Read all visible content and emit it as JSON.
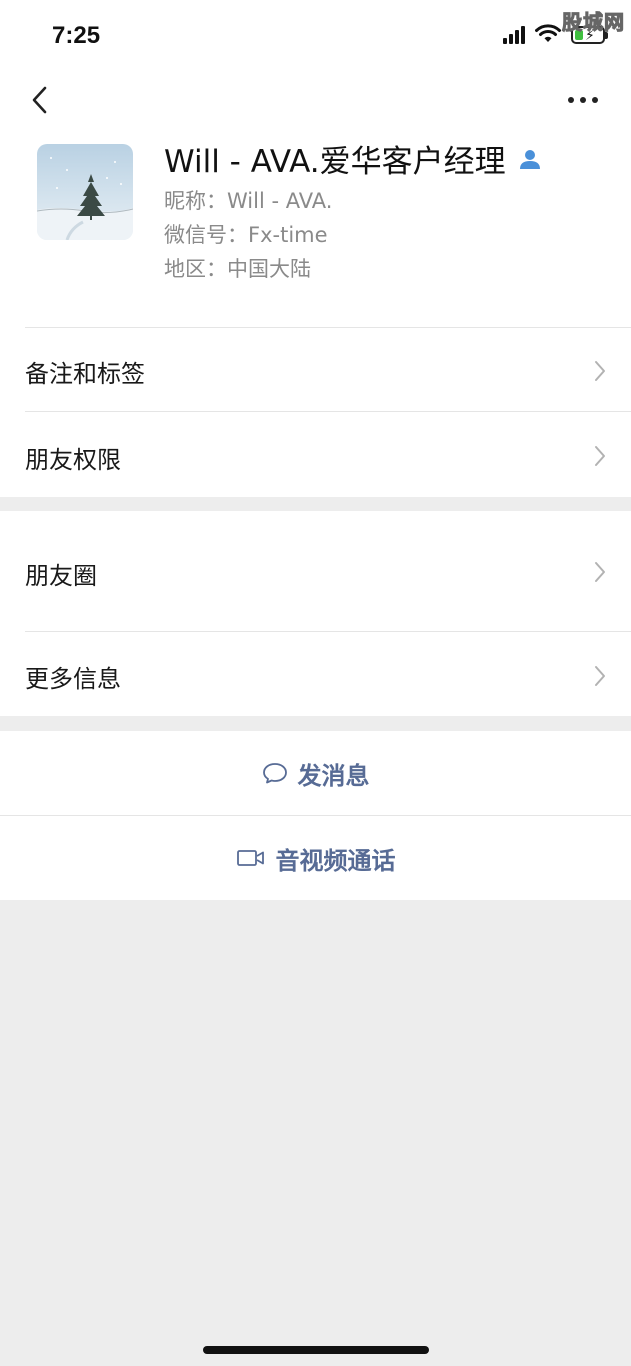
{
  "status_bar": {
    "time": "7:25",
    "watermark": "股城网",
    "icons": [
      "signal-icon",
      "wifi-icon",
      "battery-charging-icon"
    ]
  },
  "nav": {
    "back_icon": "chevron-left-icon",
    "more_icon": "more-dots-icon"
  },
  "profile": {
    "name": "Will - AVA.爱华客户经理",
    "nickname": "昵称：Will - AVA.",
    "wechat_id": "微信号：Fx-time",
    "region": "地区：中国大陆",
    "contact_icon": "contact-person-icon"
  },
  "menu": {
    "remarks_tags": "备注和标签",
    "friend_permissions": "朋友权限",
    "moments": "朋友圈",
    "more_info": "更多信息"
  },
  "actions": {
    "send_message": "发消息",
    "video_call": "音视频通话"
  },
  "colors": {
    "link": "#576b95",
    "background": "#ededed",
    "panel": "#ffffff",
    "secondary_text": "#8a8a8a"
  }
}
